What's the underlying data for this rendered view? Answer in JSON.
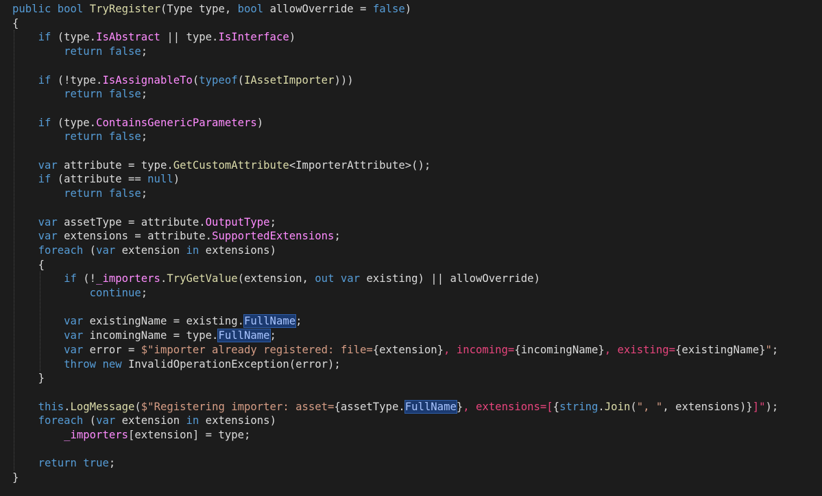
{
  "editor": {
    "language": "C#",
    "colors": {
      "background": "#1c1c1c",
      "keyword": "#569cd6",
      "plain": "#dcdcdc",
      "member": "#ff8cff",
      "method": "#dcdcaa",
      "string": "#d69d85",
      "highlight_bg": "#1b3a70"
    },
    "lines": [
      {
        "indent": 0,
        "tokens": [
          {
            "t": "kw",
            "v": "public"
          },
          {
            "t": "plain",
            "v": " "
          },
          {
            "t": "kw",
            "v": "bool"
          },
          {
            "t": "plain",
            "v": " "
          },
          {
            "t": "method",
            "v": "TryRegister"
          },
          {
            "t": "plain",
            "v": "(Type type, "
          },
          {
            "t": "kw",
            "v": "bool"
          },
          {
            "t": "plain",
            "v": " allowOverride = "
          },
          {
            "t": "kw",
            "v": "false"
          },
          {
            "t": "plain",
            "v": ")"
          }
        ]
      },
      {
        "indent": 0,
        "tokens": [
          {
            "t": "plain",
            "v": "{"
          }
        ]
      },
      {
        "indent": 1,
        "tokens": [
          {
            "t": "kw",
            "v": "if"
          },
          {
            "t": "plain",
            "v": " (type."
          },
          {
            "t": "member",
            "v": "IsAbstract"
          },
          {
            "t": "plain",
            "v": " || type."
          },
          {
            "t": "member",
            "v": "IsInterface"
          },
          {
            "t": "plain",
            "v": ")"
          }
        ]
      },
      {
        "indent": 2,
        "tokens": [
          {
            "t": "kw",
            "v": "return"
          },
          {
            "t": "plain",
            "v": " "
          },
          {
            "t": "kw",
            "v": "false"
          },
          {
            "t": "plain",
            "v": ";"
          }
        ]
      },
      {
        "indent": 0,
        "tokens": []
      },
      {
        "indent": 1,
        "tokens": [
          {
            "t": "kw",
            "v": "if"
          },
          {
            "t": "plain",
            "v": " (!type."
          },
          {
            "t": "member",
            "v": "IsAssignableTo"
          },
          {
            "t": "plain",
            "v": "("
          },
          {
            "t": "kw",
            "v": "typeof"
          },
          {
            "t": "plain",
            "v": "("
          },
          {
            "t": "type",
            "v": "IAssetImporter"
          },
          {
            "t": "plain",
            "v": ")))"
          }
        ]
      },
      {
        "indent": 2,
        "tokens": [
          {
            "t": "kw",
            "v": "return"
          },
          {
            "t": "plain",
            "v": " "
          },
          {
            "t": "kw",
            "v": "false"
          },
          {
            "t": "plain",
            "v": ";"
          }
        ]
      },
      {
        "indent": 0,
        "tokens": []
      },
      {
        "indent": 1,
        "tokens": [
          {
            "t": "kw",
            "v": "if"
          },
          {
            "t": "plain",
            "v": " (type."
          },
          {
            "t": "member",
            "v": "ContainsGenericParameters"
          },
          {
            "t": "plain",
            "v": ")"
          }
        ]
      },
      {
        "indent": 2,
        "tokens": [
          {
            "t": "kw",
            "v": "return"
          },
          {
            "t": "plain",
            "v": " "
          },
          {
            "t": "kw",
            "v": "false"
          },
          {
            "t": "plain",
            "v": ";"
          }
        ]
      },
      {
        "indent": 0,
        "tokens": []
      },
      {
        "indent": 1,
        "tokens": [
          {
            "t": "kw",
            "v": "var"
          },
          {
            "t": "plain",
            "v": " attribute = type."
          },
          {
            "t": "method",
            "v": "GetCustomAttribute"
          },
          {
            "t": "plain",
            "v": "<ImporterAttribute>();"
          }
        ]
      },
      {
        "indent": 1,
        "tokens": [
          {
            "t": "kw",
            "v": "if"
          },
          {
            "t": "plain",
            "v": " (attribute == "
          },
          {
            "t": "kw",
            "v": "null"
          },
          {
            "t": "plain",
            "v": ")"
          }
        ]
      },
      {
        "indent": 2,
        "tokens": [
          {
            "t": "kw",
            "v": "return"
          },
          {
            "t": "plain",
            "v": " "
          },
          {
            "t": "kw",
            "v": "false"
          },
          {
            "t": "plain",
            "v": ";"
          }
        ]
      },
      {
        "indent": 0,
        "tokens": []
      },
      {
        "indent": 1,
        "tokens": [
          {
            "t": "kw",
            "v": "var"
          },
          {
            "t": "plain",
            "v": " assetType = attribute."
          },
          {
            "t": "member",
            "v": "OutputType"
          },
          {
            "t": "plain",
            "v": ";"
          }
        ]
      },
      {
        "indent": 1,
        "tokens": [
          {
            "t": "kw",
            "v": "var"
          },
          {
            "t": "plain",
            "v": " extensions = attribute."
          },
          {
            "t": "member",
            "v": "SupportedExtensions"
          },
          {
            "t": "plain",
            "v": ";"
          }
        ]
      },
      {
        "indent": 1,
        "tokens": [
          {
            "t": "kw",
            "v": "foreach"
          },
          {
            "t": "plain",
            "v": " ("
          },
          {
            "t": "kw",
            "v": "var"
          },
          {
            "t": "plain",
            "v": " extension "
          },
          {
            "t": "kw",
            "v": "in"
          },
          {
            "t": "plain",
            "v": " extensions)"
          }
        ]
      },
      {
        "indent": 1,
        "tokens": [
          {
            "t": "plain",
            "v": "{"
          }
        ]
      },
      {
        "indent": 2,
        "tokens": [
          {
            "t": "kw",
            "v": "if"
          },
          {
            "t": "plain",
            "v": " (!"
          },
          {
            "t": "member",
            "v": "_importers"
          },
          {
            "t": "plain",
            "v": "."
          },
          {
            "t": "method",
            "v": "TryGetValue"
          },
          {
            "t": "plain",
            "v": "(extension, "
          },
          {
            "t": "kw",
            "v": "out"
          },
          {
            "t": "plain",
            "v": " "
          },
          {
            "t": "kw",
            "v": "var"
          },
          {
            "t": "plain",
            "v": " existing) || allowOverride)"
          }
        ]
      },
      {
        "indent": 3,
        "tokens": [
          {
            "t": "kw",
            "v": "continue"
          },
          {
            "t": "plain",
            "v": ";"
          }
        ]
      },
      {
        "indent": 0,
        "tokens": []
      },
      {
        "indent": 2,
        "tokens": [
          {
            "t": "kw",
            "v": "var"
          },
          {
            "t": "plain",
            "v": " existingName = existing."
          },
          {
            "t": "hl",
            "v": "FullName"
          },
          {
            "t": "plain",
            "v": ";"
          }
        ]
      },
      {
        "indent": 2,
        "tokens": [
          {
            "t": "kw",
            "v": "var"
          },
          {
            "t": "plain",
            "v": " incomingName = type."
          },
          {
            "t": "hl",
            "v": "FullName"
          },
          {
            "t": "plain",
            "v": ";"
          }
        ]
      },
      {
        "indent": 2,
        "tokens": [
          {
            "t": "kw",
            "v": "var"
          },
          {
            "t": "plain",
            "v": " error = "
          },
          {
            "t": "string",
            "v": "$\"importer already registered: file="
          },
          {
            "t": "plain",
            "v": "{extension}"
          },
          {
            "t": "string-red",
            "v": ", incoming="
          },
          {
            "t": "plain",
            "v": "{incomingName}"
          },
          {
            "t": "string-red",
            "v": ", existing="
          },
          {
            "t": "plain",
            "v": "{existingName}"
          },
          {
            "t": "string",
            "v": "\""
          },
          {
            "t": "plain",
            "v": ";"
          }
        ]
      },
      {
        "indent": 2,
        "tokens": [
          {
            "t": "kw",
            "v": "throw"
          },
          {
            "t": "plain",
            "v": " "
          },
          {
            "t": "kw",
            "v": "new"
          },
          {
            "t": "plain",
            "v": " InvalidOperationException(error);"
          }
        ]
      },
      {
        "indent": 1,
        "tokens": [
          {
            "t": "plain",
            "v": "}"
          }
        ]
      },
      {
        "indent": 0,
        "tokens": []
      },
      {
        "indent": 1,
        "tokens": [
          {
            "t": "kw",
            "v": "this"
          },
          {
            "t": "plain",
            "v": "."
          },
          {
            "t": "method",
            "v": "LogMessage"
          },
          {
            "t": "plain",
            "v": "("
          },
          {
            "t": "string",
            "v": "$\"Registering importer: asset="
          },
          {
            "t": "plain",
            "v": "{assetType."
          },
          {
            "t": "hl",
            "v": "FullName"
          },
          {
            "t": "plain",
            "v": "}"
          },
          {
            "t": "string-red",
            "v": ", extensions=["
          },
          {
            "t": "plain",
            "v": "{"
          },
          {
            "t": "kw",
            "v": "string"
          },
          {
            "t": "plain",
            "v": "."
          },
          {
            "t": "method",
            "v": "Join"
          },
          {
            "t": "plain",
            "v": "("
          },
          {
            "t": "string",
            "v": "\", \""
          },
          {
            "t": "plain",
            "v": ", extensions)}"
          },
          {
            "t": "string-red",
            "v": "]\""
          },
          {
            "t": "plain",
            "v": ");"
          }
        ]
      },
      {
        "indent": 1,
        "tokens": [
          {
            "t": "kw",
            "v": "foreach"
          },
          {
            "t": "plain",
            "v": " ("
          },
          {
            "t": "kw",
            "v": "var"
          },
          {
            "t": "plain",
            "v": " extension "
          },
          {
            "t": "kw",
            "v": "in"
          },
          {
            "t": "plain",
            "v": " extensions)"
          }
        ]
      },
      {
        "indent": 2,
        "tokens": [
          {
            "t": "member",
            "v": "_importers"
          },
          {
            "t": "plain",
            "v": "[extension] = type;"
          }
        ]
      },
      {
        "indent": 0,
        "tokens": []
      },
      {
        "indent": 1,
        "tokens": [
          {
            "t": "kw",
            "v": "return"
          },
          {
            "t": "plain",
            "v": " "
          },
          {
            "t": "kw",
            "v": "true"
          },
          {
            "t": "plain",
            "v": ";"
          }
        ]
      },
      {
        "indent": 0,
        "tokens": [
          {
            "t": "plain",
            "v": "}"
          }
        ]
      }
    ]
  }
}
